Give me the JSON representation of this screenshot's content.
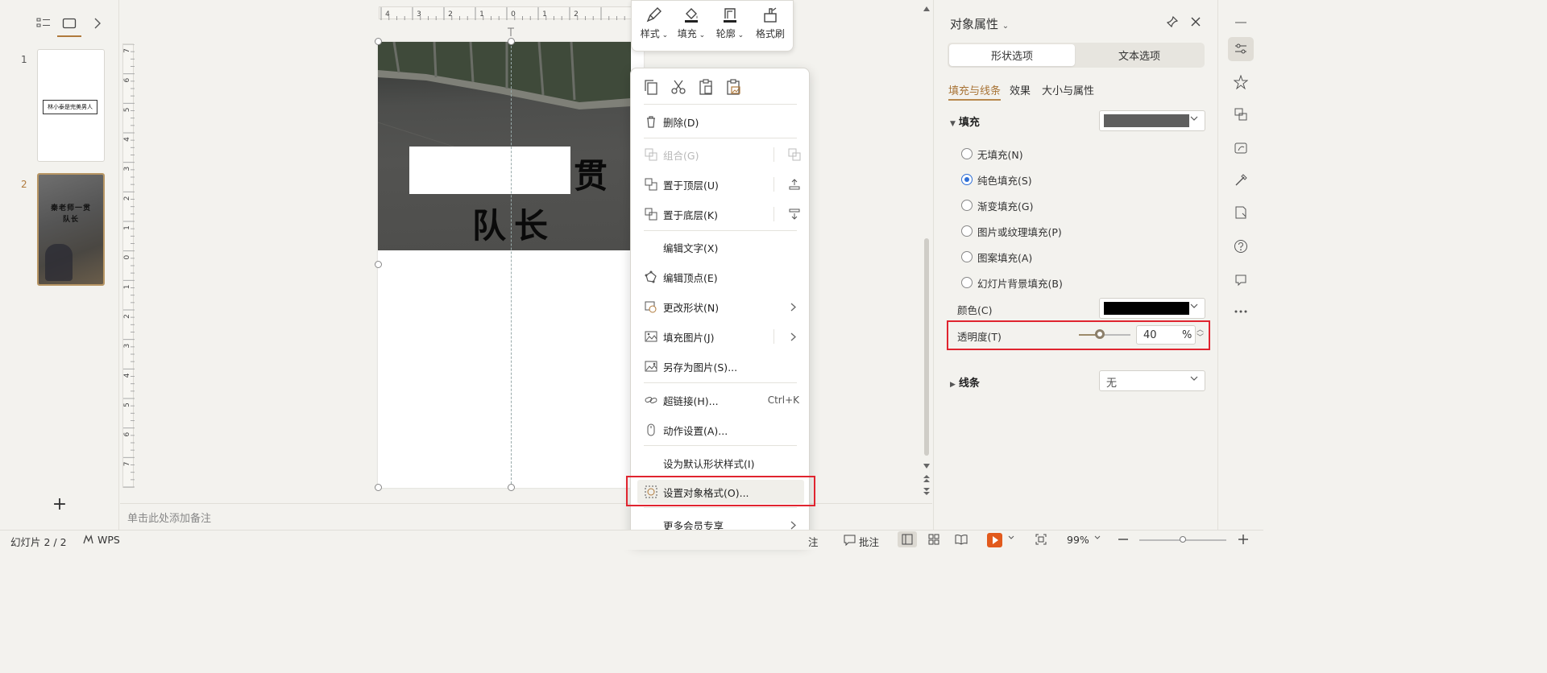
{
  "thumbnails": {
    "numbers": [
      "1",
      "2"
    ],
    "slide1_text": "林小泰是完美男人",
    "slide2_line1": "秦老师一贯",
    "slide2_line2": "队长"
  },
  "ruler": {
    "h_ticks": [
      "4",
      "3",
      "2",
      "1",
      "0",
      "1",
      "2"
    ],
    "v_ticks": [
      "7",
      "6",
      "5",
      "4",
      "3",
      "2",
      "1",
      "0",
      "1",
      "2",
      "3",
      "4",
      "5",
      "6",
      "7"
    ]
  },
  "slide": {
    "text_gong": "贯",
    "text_duizhang": "队长"
  },
  "notes": {
    "placeholder": "单击此处添加备注"
  },
  "mini_toolbar": {
    "style": "样式",
    "fill": "填充",
    "outline": "轮廓",
    "format_painter": "格式刷"
  },
  "context_menu": {
    "delete": "删除(D)",
    "group": "组合(G)",
    "bring_to_front": "置于顶层(U)",
    "send_to_back": "置于底层(K)",
    "edit_text": "编辑文字(X)",
    "edit_points": "编辑顶点(E)",
    "change_shape": "更改形状(N)",
    "fill_picture": "填充图片(J)",
    "save_as_picture": "另存为图片(S)...",
    "hyperlink": "超链接(H)...",
    "hyperlink_shortcut": "Ctrl+K",
    "action_settings": "动作设置(A)...",
    "set_default_style": "设为默认形状样式(I)",
    "format_object": "设置对象格式(O)...",
    "more_member": "更多会员专享"
  },
  "properties": {
    "title": "对象属性",
    "tab_shape": "形状选项",
    "tab_text": "文本选项",
    "subtab_fill_line": "填充与线条",
    "subtab_effects": "效果",
    "subtab_size": "大小与属性",
    "section_fill": "填充",
    "fill_swatch_color": "#5f5f5f",
    "fill_options": [
      "无填充(N)",
      "纯色填充(S)",
      "渐变填充(G)",
      "图片或纹理填充(P)",
      "图案填充(A)",
      "幻灯片背景填充(B)"
    ],
    "fill_selected_index": 1,
    "color_label": "颜色(C)",
    "color_value": "#000000",
    "transparency_label": "透明度(T)",
    "transparency_value": "40",
    "transparency_unit": "%",
    "transparency_fraction": 0.4,
    "section_line": "线条",
    "line_value": "无"
  },
  "status_bar": {
    "slide_counter": "幻灯片 2 / 2",
    "wps": "WPS",
    "notes_frag": "注",
    "comments": "批注",
    "zoom": "99%",
    "zoom_fraction": 0.5
  },
  "colors": {
    "accent": "#b07a3c",
    "highlight_red": "#e0242f",
    "play_orange": "#e25a1c",
    "radio_blue": "#2f6fd6"
  }
}
